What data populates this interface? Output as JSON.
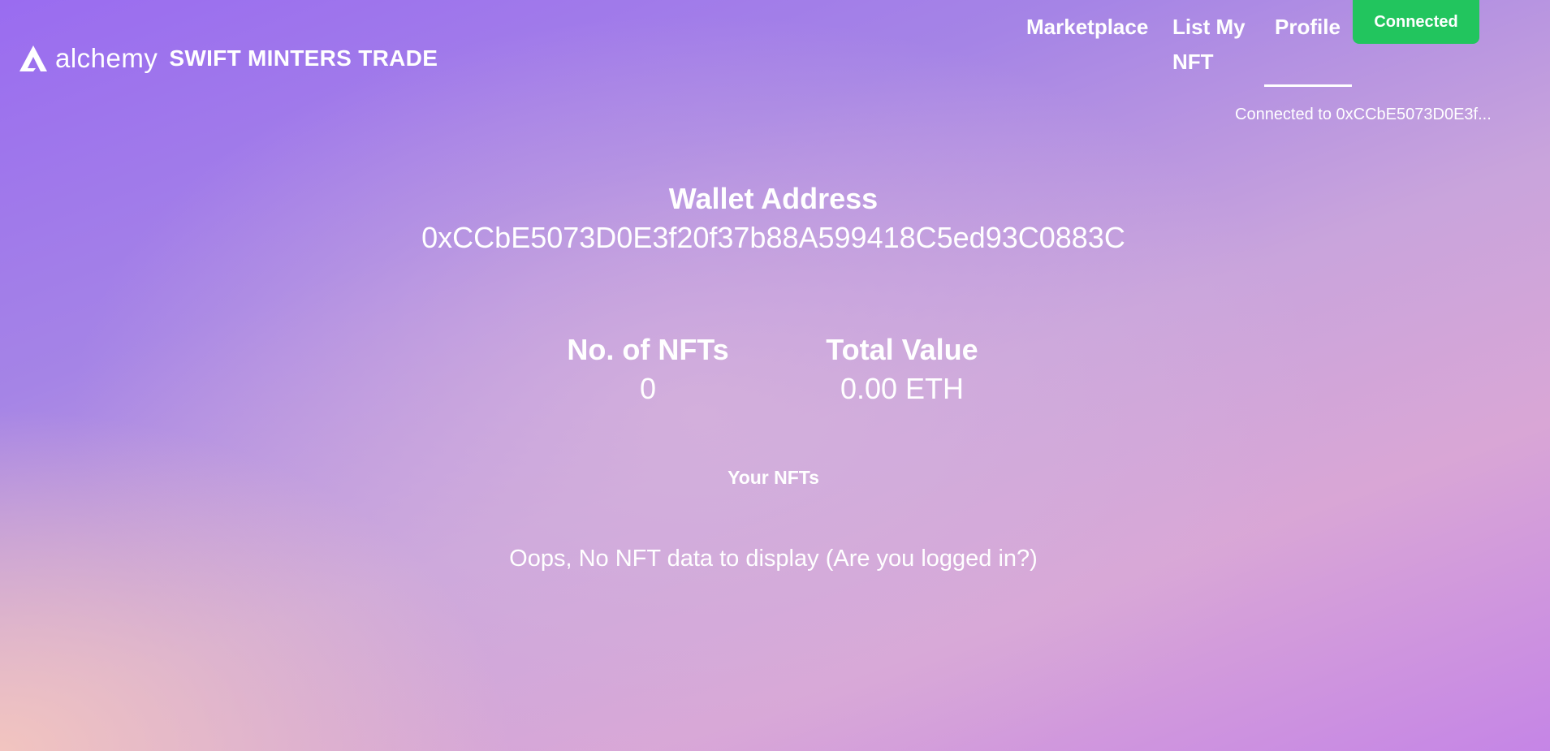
{
  "header": {
    "logo_text": "alchemy",
    "site_title": "SWIFT MINTERS TRADE",
    "nav": {
      "marketplace": "Marketplace",
      "list_my_nft": "List My NFT",
      "profile": "Profile"
    },
    "connect_button": "Connected",
    "connected_to": "Connected to 0xCCbE5073D0E3f..."
  },
  "profile": {
    "wallet_heading": "Wallet Address",
    "wallet_address": "0xCCbE5073D0E3f20f37b88A599418C5ed93C0883C",
    "nft_count_label": "No. of NFTs",
    "nft_count": "0",
    "total_value_label": "Total Value",
    "total_value": "0.00 ETH",
    "your_nfts_heading": "Your NFTs",
    "empty_message": "Oops, No NFT data to display (Are you logged in?)"
  },
  "colors": {
    "connected_button": "#22c55e",
    "text": "#ffffff"
  },
  "icons": {
    "logo": "alchemy-logo-icon"
  }
}
